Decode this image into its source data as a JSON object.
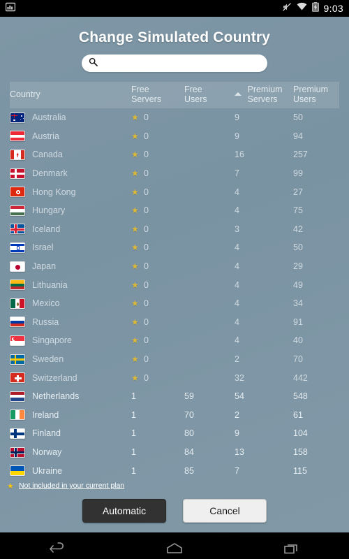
{
  "statusbar": {
    "left_icons": [
      "screenshot-icon"
    ],
    "right_icons": [
      "mute-icon",
      "wifi-icon",
      "battery-charging-icon"
    ],
    "time": "9:03"
  },
  "dialog": {
    "title": "Change Simulated Country"
  },
  "search": {
    "value": "",
    "placeholder": "",
    "icon": "search-icon"
  },
  "table": {
    "sorted_column": "Free Users",
    "sort_direction": "ascending",
    "headers": {
      "country": "Country",
      "free_servers_l1": "Free",
      "free_servers_l2": "Servers",
      "free_users_l1": "Free",
      "free_users_l2": "Users",
      "premium_servers_l1": "Premium",
      "premium_servers_l2": "Servers",
      "premium_users_l1": "Premium",
      "premium_users_l2": "Users"
    },
    "rows": [
      {
        "country": "Australia",
        "flag": "au",
        "locked": true,
        "free_servers": "0",
        "free_users": "",
        "premium_servers": "9",
        "premium_users": "50"
      },
      {
        "country": "Austria",
        "flag": "at",
        "locked": true,
        "free_servers": "0",
        "free_users": "",
        "premium_servers": "9",
        "premium_users": "94"
      },
      {
        "country": "Canada",
        "flag": "ca",
        "locked": true,
        "free_servers": "0",
        "free_users": "",
        "premium_servers": "16",
        "premium_users": "257"
      },
      {
        "country": "Denmark",
        "flag": "dk",
        "locked": true,
        "free_servers": "0",
        "free_users": "",
        "premium_servers": "7",
        "premium_users": "99"
      },
      {
        "country": "Hong Kong",
        "flag": "hk",
        "locked": true,
        "free_servers": "0",
        "free_users": "",
        "premium_servers": "4",
        "premium_users": "27"
      },
      {
        "country": "Hungary",
        "flag": "hu",
        "locked": true,
        "free_servers": "0",
        "free_users": "",
        "premium_servers": "4",
        "premium_users": "75"
      },
      {
        "country": "Iceland",
        "flag": "is",
        "locked": true,
        "free_servers": "0",
        "free_users": "",
        "premium_servers": "3",
        "premium_users": "42"
      },
      {
        "country": "Israel",
        "flag": "il",
        "locked": true,
        "free_servers": "0",
        "free_users": "",
        "premium_servers": "4",
        "premium_users": "50"
      },
      {
        "country": "Japan",
        "flag": "jp",
        "locked": true,
        "free_servers": "0",
        "free_users": "",
        "premium_servers": "4",
        "premium_users": "29"
      },
      {
        "country": "Lithuania",
        "flag": "lt",
        "locked": true,
        "free_servers": "0",
        "free_users": "",
        "premium_servers": "4",
        "premium_users": "49"
      },
      {
        "country": "Mexico",
        "flag": "mx",
        "locked": true,
        "free_servers": "0",
        "free_users": "",
        "premium_servers": "4",
        "premium_users": "34"
      },
      {
        "country": "Russia",
        "flag": "ru",
        "locked": true,
        "free_servers": "0",
        "free_users": "",
        "premium_servers": "4",
        "premium_users": "91"
      },
      {
        "country": "Singapore",
        "flag": "sg",
        "locked": true,
        "free_servers": "0",
        "free_users": "",
        "premium_servers": "4",
        "premium_users": "40"
      },
      {
        "country": "Sweden",
        "flag": "se",
        "locked": true,
        "free_servers": "0",
        "free_users": "",
        "premium_servers": "2",
        "premium_users": "70"
      },
      {
        "country": "Switzerland",
        "flag": "ch",
        "locked": true,
        "free_servers": "0",
        "free_users": "",
        "premium_servers": "32",
        "premium_users": "442"
      },
      {
        "country": "Netherlands",
        "flag": "nl",
        "locked": false,
        "free_servers": "1",
        "free_users": "59",
        "premium_servers": "54",
        "premium_users": "548"
      },
      {
        "country": "Ireland",
        "flag": "ie",
        "locked": false,
        "free_servers": "1",
        "free_users": "70",
        "premium_servers": "2",
        "premium_users": "61"
      },
      {
        "country": "Finland",
        "flag": "fi",
        "locked": false,
        "free_servers": "1",
        "free_users": "80",
        "premium_servers": "9",
        "premium_users": "104"
      },
      {
        "country": "Norway",
        "flag": "no",
        "locked": false,
        "free_servers": "1",
        "free_users": "84",
        "premium_servers": "13",
        "premium_users": "158"
      },
      {
        "country": "Ukraine",
        "flag": "ua",
        "locked": false,
        "free_servers": "1",
        "free_users": "85",
        "premium_servers": "7",
        "premium_users": "115"
      }
    ]
  },
  "note": {
    "icon": "star-icon",
    "text": "Not included in your current plan"
  },
  "buttons": {
    "automatic": "Automatic",
    "cancel": "Cancel"
  },
  "navbar": {
    "back": "back-icon",
    "home": "home-icon",
    "recents": "recents-icon"
  },
  "colors": {
    "background": "#7b95a5",
    "header_row": "#93a5af",
    "star": "#f5c518",
    "primary_button": "#333232",
    "secondary_button": "#efefef"
  }
}
